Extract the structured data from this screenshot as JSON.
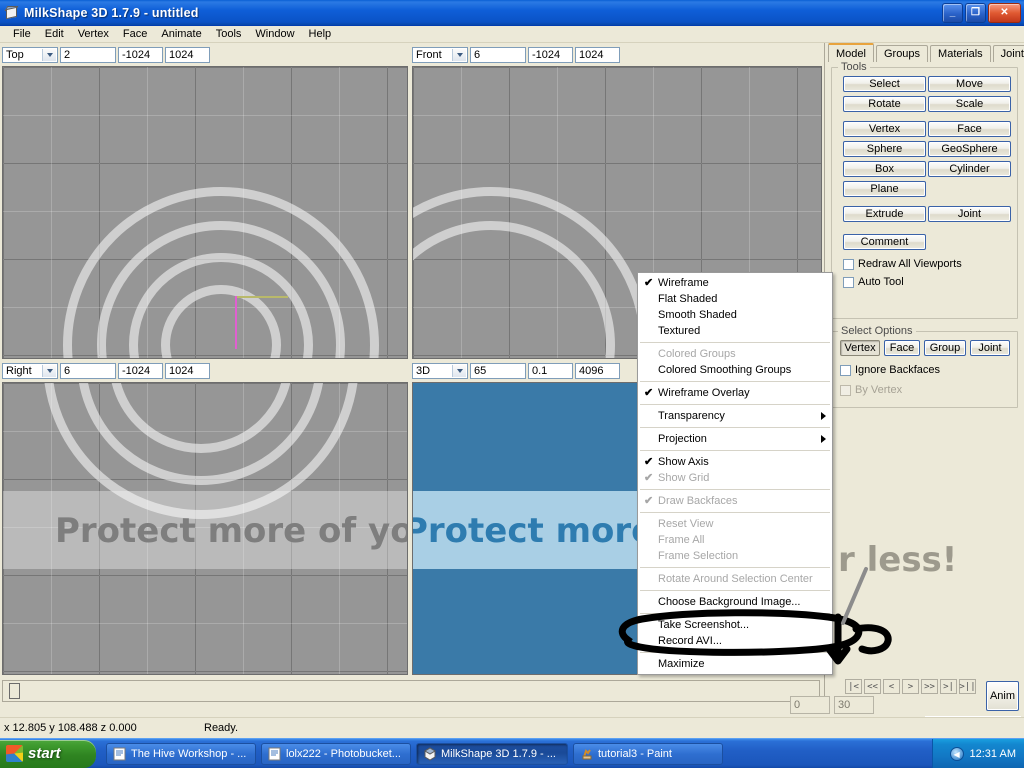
{
  "window": {
    "title": "MilkShape 3D 1.7.9 - untitled",
    "icon": "cube-icon",
    "buttons": [
      {
        "name": "minimize",
        "glyph": "_"
      },
      {
        "name": "restore",
        "glyph": "❐"
      },
      {
        "name": "close",
        "glyph": "✕"
      }
    ]
  },
  "menubar": {
    "items": [
      "File",
      "Edit",
      "Vertex",
      "Face",
      "Animate",
      "Tools",
      "Window",
      "Help"
    ]
  },
  "viewports": [
    {
      "name": "top",
      "view": "Top",
      "field1": "2",
      "field2": "-1024",
      "field3": "1024"
    },
    {
      "name": "front",
      "view": "Front",
      "field1": "6",
      "field2": "-1024",
      "field3": "1024"
    },
    {
      "name": "right",
      "view": "Right",
      "field1": "6",
      "field2": "-1024",
      "field3": "1024"
    },
    {
      "name": "3d",
      "view": "3D",
      "field1": "65",
      "field2": "0.1",
      "field3": "4096"
    }
  ],
  "watermark": {
    "line1": "Protect more of your men",
    "line2": "r less!",
    "band_dark": "#3a7aa8",
    "band_light": "#a9cfe5",
    "text_color": "#2e7cb0"
  },
  "dock": {
    "tabs": [
      {
        "label": "Model",
        "active": true
      },
      {
        "label": "Groups",
        "active": false
      },
      {
        "label": "Materials",
        "active": false
      },
      {
        "label": "Joints",
        "active": false
      }
    ],
    "tools": {
      "legend": "Tools",
      "buttons": [
        [
          "Select",
          "Move"
        ],
        [
          "Rotate",
          "Scale"
        ],
        [
          "Vertex",
          "Face"
        ],
        [
          "Sphere",
          "GeoSphere"
        ],
        [
          "Box",
          "Cylinder"
        ],
        [
          "Plane",
          ""
        ],
        [
          "Extrude",
          "Joint"
        ]
      ],
      "comment": "Comment",
      "checkboxes": [
        {
          "label": "Redraw All Viewports",
          "checked": false,
          "disabled": false
        },
        {
          "label": "Auto Tool",
          "checked": false,
          "disabled": false
        }
      ]
    },
    "select_options": {
      "legend": "Select Options",
      "buttons": [
        {
          "label": "Vertex",
          "pressed": true
        },
        {
          "label": "Face",
          "pressed": false
        },
        {
          "label": "Group",
          "pressed": false
        },
        {
          "label": "Joint",
          "pressed": false
        }
      ],
      "checkboxes": [
        {
          "label": "Ignore Backfaces",
          "checked": false,
          "disabled": false
        },
        {
          "label": "By Vertex",
          "checked": false,
          "disabled": true
        }
      ]
    }
  },
  "context_menu": {
    "items": [
      {
        "label": "Wireframe",
        "checked": true,
        "disabled": false,
        "submenu": false
      },
      {
        "label": "Flat Shaded",
        "checked": false,
        "disabled": false,
        "submenu": false
      },
      {
        "label": "Smooth Shaded",
        "checked": false,
        "disabled": false,
        "submenu": false
      },
      {
        "label": "Textured",
        "checked": false,
        "disabled": false,
        "submenu": false
      },
      {
        "separator": true
      },
      {
        "label": "Colored Groups",
        "checked": false,
        "disabled": true,
        "submenu": false
      },
      {
        "label": "Colored Smoothing Groups",
        "checked": false,
        "disabled": false,
        "submenu": false
      },
      {
        "separator": true
      },
      {
        "label": "Wireframe Overlay",
        "checked": true,
        "disabled": false,
        "submenu": false
      },
      {
        "separator": true
      },
      {
        "label": "Transparency",
        "checked": false,
        "disabled": false,
        "submenu": true
      },
      {
        "separator": true
      },
      {
        "label": "Projection",
        "checked": false,
        "disabled": false,
        "submenu": true
      },
      {
        "separator": true
      },
      {
        "label": "Show Axis",
        "checked": true,
        "disabled": false,
        "submenu": false
      },
      {
        "label": "Show Grid",
        "checked": true,
        "disabled": true,
        "submenu": false
      },
      {
        "separator": true
      },
      {
        "label": "Draw Backfaces",
        "checked": true,
        "disabled": true,
        "submenu": false
      },
      {
        "separator": true
      },
      {
        "label": "Reset View",
        "checked": false,
        "disabled": true,
        "submenu": false
      },
      {
        "label": "Frame All",
        "checked": false,
        "disabled": true,
        "submenu": false
      },
      {
        "label": "Frame Selection",
        "checked": false,
        "disabled": true,
        "submenu": false
      },
      {
        "separator": true
      },
      {
        "label": "Rotate Around Selection Center",
        "checked": false,
        "disabled": true,
        "submenu": false
      },
      {
        "separator": true
      },
      {
        "label": "Choose Background Image...",
        "checked": false,
        "disabled": false,
        "submenu": false
      },
      {
        "separator": true
      },
      {
        "label": "Take Screenshot...",
        "checked": false,
        "disabled": false,
        "submenu": false
      },
      {
        "label": "Record AVI...",
        "checked": false,
        "disabled": false,
        "submenu": false
      },
      {
        "separator": true
      },
      {
        "label": "Maximize",
        "checked": false,
        "disabled": false,
        "submenu": false
      }
    ]
  },
  "animation": {
    "frame_start": "0",
    "frame_end": "30",
    "transport": [
      "|<",
      "<<",
      "<",
      ">",
      ">>",
      ">|",
      ">||"
    ],
    "anim_button": "Anim"
  },
  "statusbar": {
    "coords": "x 12.805 y 108.488 z 0.000",
    "status": "Ready."
  },
  "taskbar": {
    "start": "start",
    "items": [
      {
        "label": "The Hive Workshop - ...",
        "icon": "ie-icon",
        "active": false
      },
      {
        "label": "lolx222 - Photobucket...",
        "icon": "ie-icon",
        "active": false
      },
      {
        "label": "MilkShape 3D 1.7.9 - ...",
        "icon": "cube-icon",
        "active": true
      },
      {
        "label": "tutorial3 - Paint",
        "icon": "paint-icon",
        "active": false
      }
    ],
    "clock": "12:31 AM"
  }
}
